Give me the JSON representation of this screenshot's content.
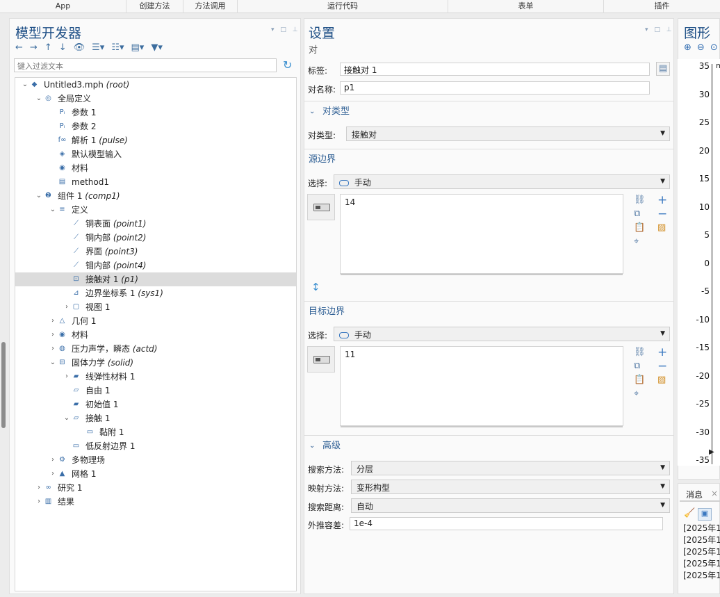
{
  "ribbon": [
    "App",
    "创建方法",
    "方法调用",
    "运行代码",
    "表单",
    "插件"
  ],
  "model_builder": {
    "title": "模型开发器",
    "filter_placeholder": "键入过滤文本",
    "tree": [
      {
        "label": "Untitled3.mph",
        "extra": "(root)",
        "level": 0,
        "twisty": "v",
        "icon": "comsol-logo-icon"
      },
      {
        "label": "全局定义",
        "extra": "",
        "level": 1,
        "twisty": "v",
        "icon": "globe-icon"
      },
      {
        "label": "参数 1",
        "extra": "",
        "level": 2,
        "twisty": "",
        "icon": "parameter-icon"
      },
      {
        "label": "参数 2",
        "extra": "",
        "level": 2,
        "twisty": "",
        "icon": "parameter-icon"
      },
      {
        "label": "解析 1",
        "extra": "(pulse)",
        "level": 2,
        "twisty": "",
        "icon": "analytic-function-icon"
      },
      {
        "label": "默认模型输入",
        "extra": "",
        "level": 2,
        "twisty": "",
        "icon": "model-input-icon"
      },
      {
        "label": "材料",
        "extra": "",
        "level": 2,
        "twisty": "",
        "icon": "materials-icon"
      },
      {
        "label": "method1",
        "extra": "",
        "level": 2,
        "twisty": "",
        "icon": "method-icon"
      },
      {
        "label": "组件 1",
        "extra": "(comp1)",
        "level": 1,
        "twisty": "v",
        "icon": "component-icon"
      },
      {
        "label": "定义",
        "extra": "",
        "level": 2,
        "twisty": "v",
        "icon": "definitions-icon"
      },
      {
        "label": "铜表面",
        "extra": "(point1)",
        "level": 3,
        "twisty": "",
        "icon": "probe-icon"
      },
      {
        "label": "铜内部",
        "extra": "(point2)",
        "level": 3,
        "twisty": "",
        "icon": "probe-icon"
      },
      {
        "label": "界面",
        "extra": "(point3)",
        "level": 3,
        "twisty": "",
        "icon": "probe-icon"
      },
      {
        "label": "钼内部",
        "extra": "(point4)",
        "level": 3,
        "twisty": "",
        "icon": "probe-icon"
      },
      {
        "label": "接触对 1",
        "extra": "(p1)",
        "level": 3,
        "twisty": "",
        "icon": "contact-pair-icon",
        "selected": true
      },
      {
        "label": "边界坐标系 1",
        "extra": "(sys1)",
        "level": 3,
        "twisty": "",
        "icon": "coordinate-system-icon"
      },
      {
        "label": "视图 1",
        "extra": "",
        "level": 3,
        "twisty": ">",
        "icon": "view-icon"
      },
      {
        "label": "几何 1",
        "extra": "",
        "level": 2,
        "twisty": ">",
        "icon": "geometry-icon"
      },
      {
        "label": "材料",
        "extra": "",
        "level": 2,
        "twisty": ">",
        "icon": "materials-icon"
      },
      {
        "label": "压力声学，瞬态",
        "extra": "(actd)",
        "level": 2,
        "twisty": ">",
        "icon": "acoustics-icon"
      },
      {
        "label": "固体力学",
        "extra": "(solid)",
        "level": 2,
        "twisty": "v",
        "icon": "solid-mechanics-icon"
      },
      {
        "label": "线弹性材料 1",
        "extra": "",
        "level": 3,
        "twisty": ">",
        "icon": "linear-elastic-icon"
      },
      {
        "label": "自由 1",
        "extra": "",
        "level": 3,
        "twisty": "",
        "icon": "free-icon"
      },
      {
        "label": "初始值 1",
        "extra": "",
        "level": 3,
        "twisty": "",
        "icon": "initial-values-icon"
      },
      {
        "label": "接触 1",
        "extra": "",
        "level": 3,
        "twisty": "v",
        "icon": "contact-icon"
      },
      {
        "label": "黏附 1",
        "extra": "",
        "level": 4,
        "twisty": "",
        "icon": "adhesion-icon"
      },
      {
        "label": "低反射边界 1",
        "extra": "",
        "level": 3,
        "twisty": "",
        "icon": "low-reflecting-icon"
      },
      {
        "label": "多物理场",
        "extra": "",
        "level": 2,
        "twisty": ">",
        "icon": "multiphysics-icon"
      },
      {
        "label": "网格 1",
        "extra": "",
        "level": 2,
        "twisty": ">",
        "icon": "mesh-icon"
      },
      {
        "label": "研究 1",
        "extra": "",
        "level": 1,
        "twisty": ">",
        "icon": "study-icon"
      },
      {
        "label": "结果",
        "extra": "",
        "level": 1,
        "twisty": ">",
        "icon": "results-icon"
      }
    ]
  },
  "settings": {
    "title": "设置",
    "subtitle": "对",
    "label_caption": "标签:",
    "label_value": "接触对 1",
    "pairname_caption": "对名称:",
    "pairname_value": "p1",
    "pair_type_section": "对类型",
    "pair_type_caption": "对类型:",
    "pair_type_value": "接触对",
    "source_section": "源边界",
    "source_select_caption": "选择:",
    "source_select_value": "手动",
    "source_list": "14",
    "dest_section": "目标边界",
    "dest_select_caption": "选择:",
    "dest_select_value": "手动",
    "dest_list": "11",
    "advanced_section": "高级",
    "search_method_caption": "搜索方法:",
    "search_method_value": "分层",
    "mapping_method_caption": "映射方法:",
    "mapping_method_value": "变形构型",
    "search_distance_caption": "搜索距离:",
    "search_distance_value": "自动",
    "extrap_caption": "外推容差:",
    "extrap_value": "1e-4"
  },
  "graphics": {
    "title": "图形",
    "ticks": [
      "35",
      "30",
      "25",
      "20",
      "15",
      "10",
      "5",
      "0",
      "-5",
      "-10",
      "-15",
      "-20",
      "-25",
      "-30",
      "-35"
    ],
    "axis_marker": "m"
  },
  "messages": {
    "tab_label": "消息",
    "lines": [
      "[2025年1",
      "[2025年1",
      "[2025年1",
      "[2025年1",
      "[2025年1"
    ]
  }
}
